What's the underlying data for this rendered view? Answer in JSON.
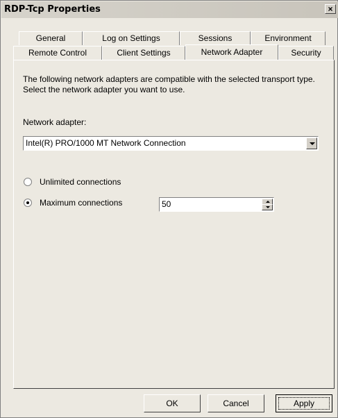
{
  "window": {
    "title": "RDP-Tcp Properties",
    "close_label": "×"
  },
  "tabs": {
    "row1": [
      "General",
      "Log on Settings",
      "Sessions",
      "Environment"
    ],
    "row2": [
      "Remote Control",
      "Client Settings",
      "Network Adapter",
      "Security"
    ],
    "active": "Network Adapter"
  },
  "panel": {
    "description": "The following network adapters are compatible with the selected transport type. Select the network adapter you want to use.",
    "adapter_label": "Network adapter:",
    "adapter_value": "Intel(R) PRO/1000 MT Network Connection",
    "unlimited_label": "Unlimited connections",
    "maximum_label": "Maximum connections",
    "maximum_value": "50",
    "selected_option": "maximum"
  },
  "buttons": {
    "ok": "OK",
    "cancel": "Cancel",
    "apply": "Apply"
  }
}
